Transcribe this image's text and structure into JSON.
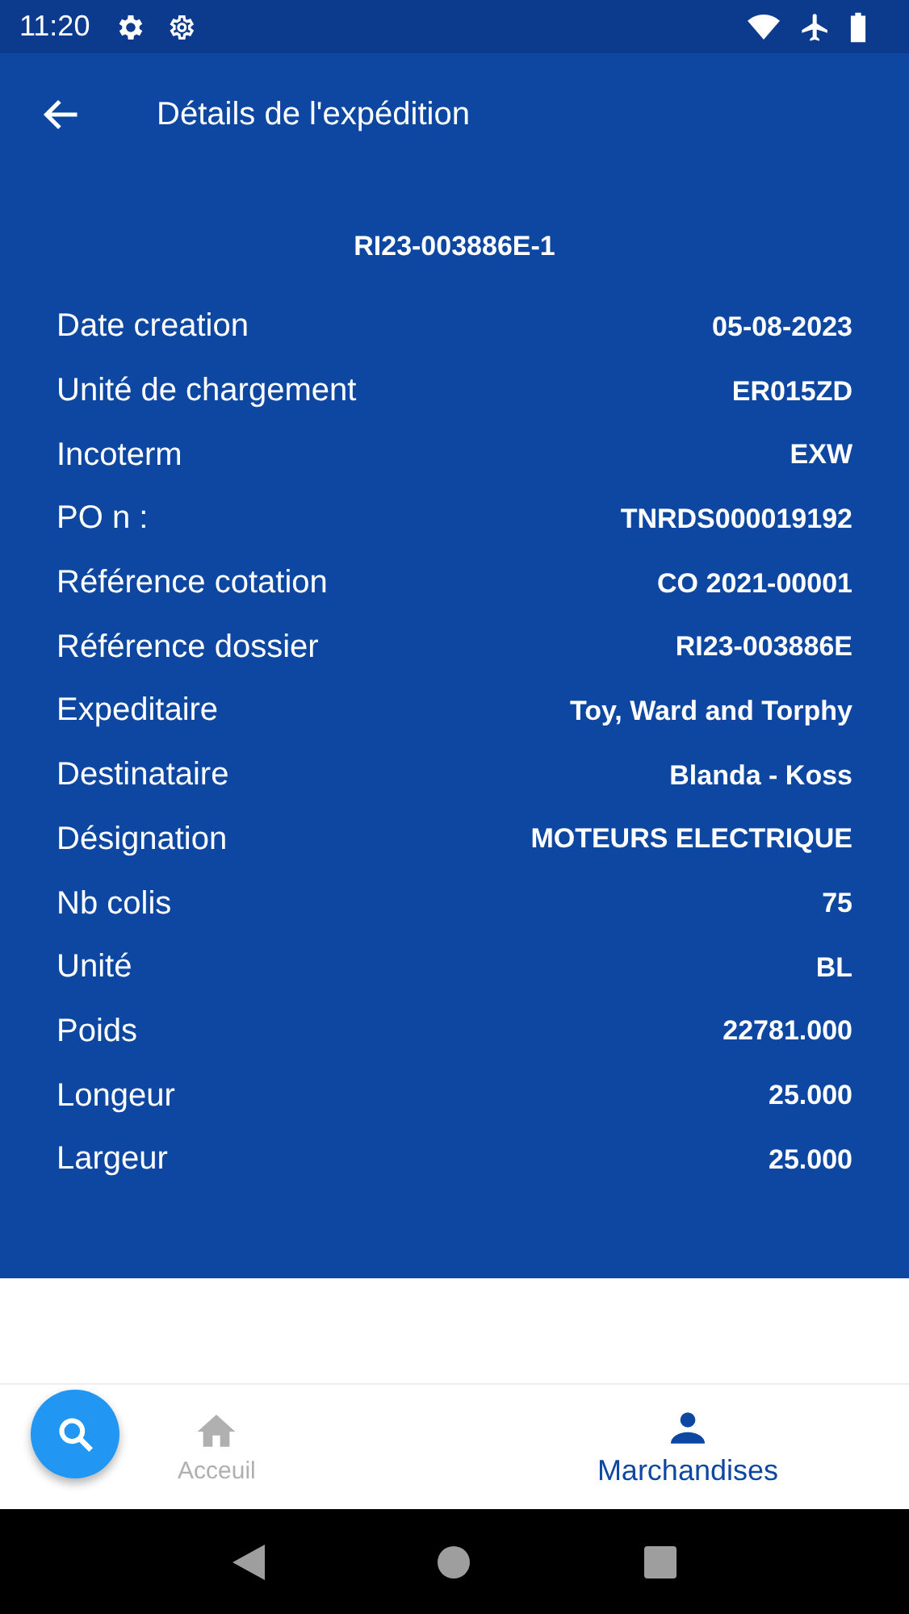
{
  "status_bar": {
    "time": "11:20"
  },
  "app_bar": {
    "title": "Détails de l'expédition"
  },
  "shipment": {
    "reference": "RI23-003886E-1",
    "fields": [
      {
        "label": "Date creation",
        "value": "05-08-2023"
      },
      {
        "label": "Unité de chargement",
        "value": "ER015ZD"
      },
      {
        "label": "Incoterm",
        "value": "EXW"
      },
      {
        "label": "PO n :",
        "value": "TNRDS000019192"
      },
      {
        "label": "Référence cotation",
        "value": "CO 2021-00001"
      },
      {
        "label": "Référence dossier",
        "value": "RI23-003886E"
      },
      {
        "label": "Expeditaire",
        "value": "Toy, Ward and Torphy"
      },
      {
        "label": "Destinataire",
        "value": "Blanda - Koss"
      },
      {
        "label": "Désignation",
        "value": "MOTEURS ELECTRIQUE"
      },
      {
        "label": "Nb colis",
        "value": "75"
      },
      {
        "label": "Unité",
        "value": "BL"
      },
      {
        "label": "Poids",
        "value": "22781.000"
      },
      {
        "label": "Longeur",
        "value": "25.000"
      },
      {
        "label": "Largeur",
        "value": "25.000"
      }
    ]
  },
  "bottom_nav": [
    {
      "kind": "home",
      "label": "Acceuil",
      "selected": false
    },
    {
      "kind": "person",
      "label": "Marchandises",
      "selected": true
    }
  ]
}
